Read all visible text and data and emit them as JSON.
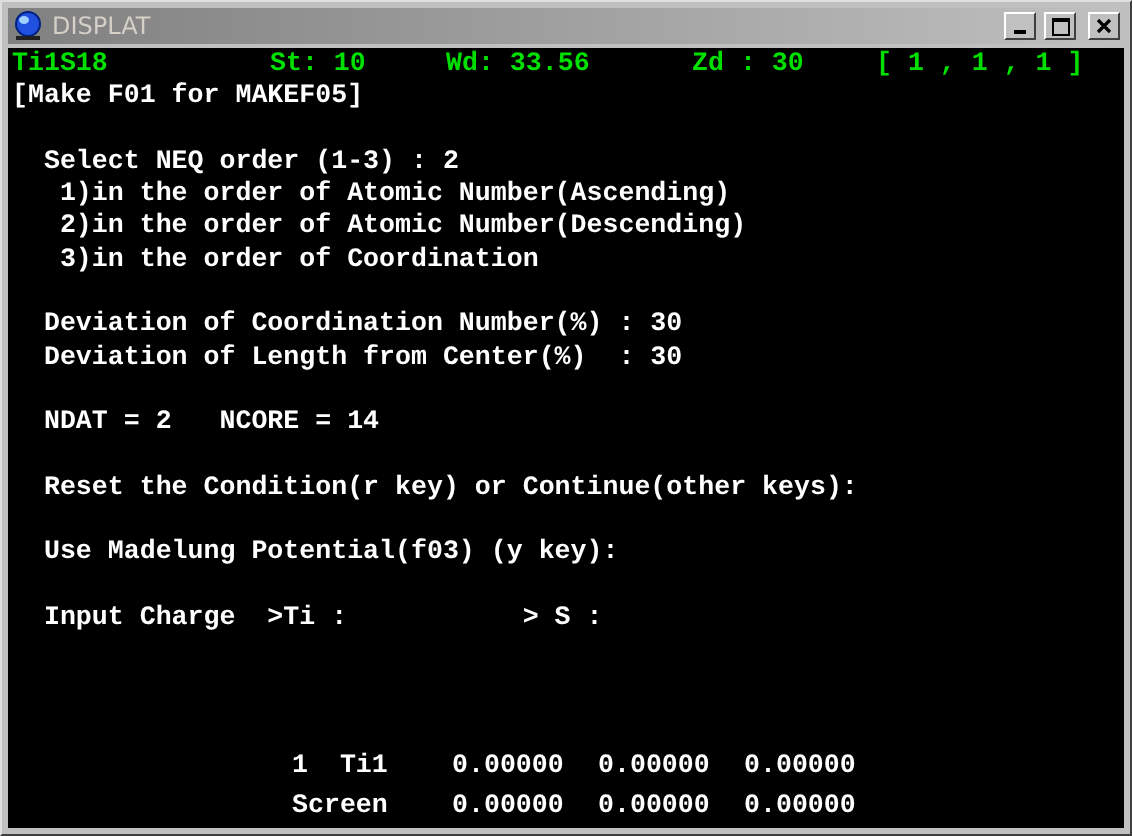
{
  "window": {
    "title": "DISPLAT",
    "active": false
  },
  "status": {
    "label": "Ti1S18",
    "st": "St: 10",
    "wd": "Wd: 33.56",
    "zd": "Zd : 30",
    "index": "[ 1 , 1 , 1 ]"
  },
  "header": "[Make F01 for MAKEF05]",
  "paragraphs": [
    [
      "  Select NEQ order (1-3) : 2",
      "   1)in the order of Atomic Number(Ascending)",
      "   2)in the order of Atomic Number(Descending)",
      "   3)in the order of Coordination"
    ],
    [
      "  Deviation of Coordination Number(%) : 30",
      "  Deviation of Length from Center(%)  : 30"
    ],
    [
      "  NDAT = 2   NCORE = 14"
    ],
    [
      "  Reset the Condition(r key) or Continue(other keys):"
    ],
    [
      "  Use Madelung Potential(f03) (y key):"
    ],
    [
      "  Input Charge  >Ti :           > S :"
    ]
  ],
  "table": {
    "rows": [
      [
        "1  Ti1",
        "0.00000",
        "0.00000",
        "0.00000"
      ],
      [
        "Screen",
        "0.00000",
        "0.00000",
        "0.00000"
      ]
    ]
  }
}
